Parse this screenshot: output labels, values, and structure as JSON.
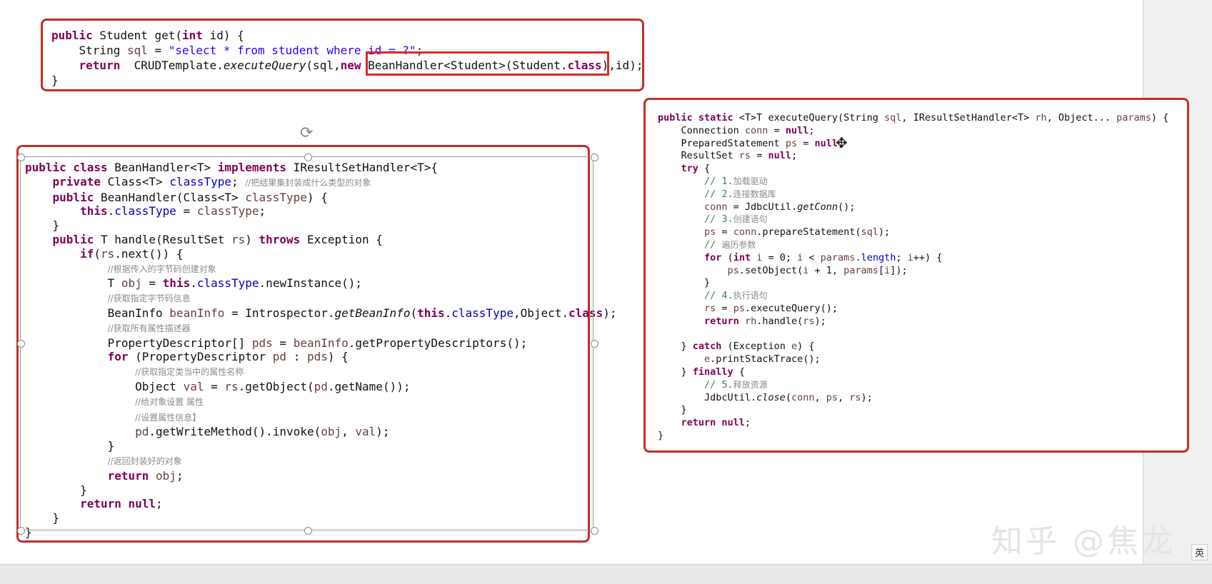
{
  "accent_color": "#c0302a",
  "watermark": "知乎 @焦龙",
  "ime": "英",
  "get_method": {
    "lines": [
      [
        [
          "kw",
          "public"
        ],
        [
          "t",
          " Student get("
        ],
        [
          "kw",
          "int"
        ],
        [
          "t",
          " id) {"
        ]
      ],
      [
        [
          "t",
          "    String "
        ],
        [
          "var",
          "sql"
        ],
        [
          "t",
          " = "
        ],
        [
          "str",
          "\"select * from student where id = ?\""
        ],
        [
          "t",
          ";"
        ]
      ],
      [
        [
          "t",
          "    "
        ],
        [
          "kw",
          "return"
        ],
        [
          "t",
          "  CRUDTemplate."
        ],
        [
          "mth",
          "executeQuery"
        ],
        [
          "t",
          "(sql,"
        ],
        [
          "kw",
          "new"
        ],
        [
          "t",
          " BeanHandler<Student>(Student."
        ],
        [
          "kw",
          "class"
        ],
        [
          "t",
          "),id);"
        ]
      ],
      [
        [
          "t",
          "}"
        ]
      ]
    ]
  },
  "bean_handler": {
    "lines": [
      [
        [
          "kw",
          "public class"
        ],
        [
          "t",
          " BeanHandler<T> "
        ],
        [
          "kw",
          "implements"
        ],
        [
          "t",
          " IResultSetHandler<T>{"
        ]
      ],
      [
        [
          "t",
          "    "
        ],
        [
          "kw",
          "private"
        ],
        [
          "t",
          " Class<T> "
        ],
        [
          "fld",
          "classType"
        ],
        [
          "t",
          "; "
        ],
        [
          "cmt",
          "//把结果集封装成什么类型的对象"
        ]
      ],
      [
        [
          "t",
          "    "
        ],
        [
          "kw",
          "public"
        ],
        [
          "t",
          " BeanHandler(Class<T> "
        ],
        [
          "var",
          "classType"
        ],
        [
          "t",
          ") {"
        ]
      ],
      [
        [
          "t",
          "        "
        ],
        [
          "kw",
          "this"
        ],
        [
          "t",
          "."
        ],
        [
          "fld",
          "classType"
        ],
        [
          "t",
          " = "
        ],
        [
          "var",
          "classType"
        ],
        [
          "t",
          ";"
        ]
      ],
      [
        [
          "t",
          "    }"
        ]
      ],
      [
        [
          "t",
          "    "
        ],
        [
          "kw",
          "public"
        ],
        [
          "t",
          " T handle(ResultSet "
        ],
        [
          "var",
          "rs"
        ],
        [
          "t",
          ") "
        ],
        [
          "kw",
          "throws"
        ],
        [
          "t",
          " Exception {"
        ]
      ],
      [
        [
          "t",
          "        "
        ],
        [
          "kw",
          "if"
        ],
        [
          "t",
          "("
        ],
        [
          "var",
          "rs"
        ],
        [
          "t",
          ".next()) {"
        ]
      ],
      [
        [
          "t",
          "            "
        ],
        [
          "cmt",
          "//根据传入的字节码创建对象"
        ]
      ],
      [
        [
          "t",
          "            T "
        ],
        [
          "var",
          "obj"
        ],
        [
          "t",
          " = "
        ],
        [
          "kw",
          "this"
        ],
        [
          "t",
          "."
        ],
        [
          "fld",
          "classType"
        ],
        [
          "t",
          ".newInstance();"
        ]
      ],
      [
        [
          "t",
          "            "
        ],
        [
          "cmt",
          "//获取指定字节码信息"
        ]
      ],
      [
        [
          "t",
          "            BeanInfo "
        ],
        [
          "var",
          "beanInfo"
        ],
        [
          "t",
          " = Introspector."
        ],
        [
          "mth",
          "getBeanInfo"
        ],
        [
          "t",
          "("
        ],
        [
          "kw",
          "this"
        ],
        [
          "t",
          "."
        ],
        [
          "fld",
          "classType"
        ],
        [
          "t",
          ",Object."
        ],
        [
          "kw",
          "class"
        ],
        [
          "t",
          ");"
        ]
      ],
      [
        [
          "t",
          "            "
        ],
        [
          "cmt",
          "//获取所有属性描述器"
        ]
      ],
      [
        [
          "t",
          "            PropertyDescriptor[] "
        ],
        [
          "var",
          "pds"
        ],
        [
          "t",
          " = "
        ],
        [
          "var",
          "beanInfo"
        ],
        [
          "t",
          ".getPropertyDescriptors();"
        ]
      ],
      [
        [
          "t",
          "            "
        ],
        [
          "kw",
          "for"
        ],
        [
          "t",
          " (PropertyDescriptor "
        ],
        [
          "var",
          "pd"
        ],
        [
          "t",
          " : "
        ],
        [
          "var",
          "pds"
        ],
        [
          "t",
          ") {"
        ]
      ],
      [
        [
          "t",
          "                "
        ],
        [
          "cmt",
          "//获取指定类当中的属性名称"
        ]
      ],
      [
        [
          "t",
          "                Object "
        ],
        [
          "var",
          "val"
        ],
        [
          "t",
          " = "
        ],
        [
          "var",
          "rs"
        ],
        [
          "t",
          ".getObject("
        ],
        [
          "var",
          "pd"
        ],
        [
          "t",
          ".getName());"
        ]
      ],
      [
        [
          "t",
          "                "
        ],
        [
          "cmt",
          "//给对象设置 属性"
        ]
      ],
      [
        [
          "t",
          "                "
        ],
        [
          "cmt",
          "//设置属性信息】"
        ]
      ],
      [
        [
          "t",
          "                "
        ],
        [
          "var",
          "pd"
        ],
        [
          "t",
          ".getWriteMethod().invoke("
        ],
        [
          "var",
          "obj"
        ],
        [
          "t",
          ", "
        ],
        [
          "var",
          "val"
        ],
        [
          "t",
          ");"
        ]
      ],
      [
        [
          "t",
          "            }"
        ]
      ],
      [
        [
          "t",
          "            "
        ],
        [
          "cmt",
          "//返回封装好的对象"
        ]
      ],
      [
        [
          "t",
          "            "
        ],
        [
          "kw",
          "return"
        ],
        [
          "t",
          " "
        ],
        [
          "var",
          "obj"
        ],
        [
          "t",
          ";"
        ]
      ],
      [
        [
          "t",
          "        }"
        ]
      ],
      [
        [
          "t",
          "        "
        ],
        [
          "kw",
          "return null"
        ],
        [
          "t",
          ";"
        ]
      ],
      [
        [
          "t",
          "    }"
        ]
      ],
      [
        [
          "t",
          "}"
        ]
      ]
    ]
  },
  "execute_query": {
    "lines": [
      [
        [
          "kw",
          "public static"
        ],
        [
          "t",
          " <T>T executeQuery(String "
        ],
        [
          "var",
          "sql"
        ],
        [
          "t",
          ", IResultSetHandler<T> "
        ],
        [
          "var",
          "rh"
        ],
        [
          "t",
          ", Object... "
        ],
        [
          "var",
          "params"
        ],
        [
          "t",
          ") {"
        ]
      ],
      [
        [
          "t",
          "    Connection "
        ],
        [
          "var",
          "conn"
        ],
        [
          "t",
          " = "
        ],
        [
          "kw",
          "null"
        ],
        [
          "t",
          ";"
        ]
      ],
      [
        [
          "t",
          "    PreparedStatement "
        ],
        [
          "var",
          "ps"
        ],
        [
          "t",
          " = "
        ],
        [
          "kw",
          "null"
        ],
        [
          "t",
          ";"
        ]
      ],
      [
        [
          "t",
          "    ResultSet "
        ],
        [
          "var",
          "rs"
        ],
        [
          "t",
          " = "
        ],
        [
          "kw",
          "null"
        ],
        [
          "t",
          ";"
        ]
      ],
      [
        [
          "t",
          "    "
        ],
        [
          "kw",
          "try"
        ],
        [
          "t",
          " {"
        ]
      ],
      [
        [
          "t",
          "        "
        ],
        [
          "cmtnum",
          "// 1."
        ],
        [
          "cmt",
          "加载驱动"
        ]
      ],
      [
        [
          "t",
          "        "
        ],
        [
          "cmtnum",
          "// 2."
        ],
        [
          "cmt",
          "连接数据库"
        ]
      ],
      [
        [
          "t",
          "        "
        ],
        [
          "var",
          "conn"
        ],
        [
          "t",
          " = JdbcUtil."
        ],
        [
          "mth",
          "getConn"
        ],
        [
          "t",
          "();"
        ]
      ],
      [
        [
          "t",
          "        "
        ],
        [
          "cmtnum",
          "// 3."
        ],
        [
          "cmt",
          "创建语句"
        ]
      ],
      [
        [
          "t",
          "        "
        ],
        [
          "var",
          "ps"
        ],
        [
          "t",
          " = "
        ],
        [
          "var",
          "conn"
        ],
        [
          "t",
          ".prepareStatement("
        ],
        [
          "var",
          "sql"
        ],
        [
          "t",
          ");"
        ]
      ],
      [
        [
          "t",
          "        "
        ],
        [
          "cmtnum",
          "// "
        ],
        [
          "cmt",
          "遍历参数"
        ]
      ],
      [
        [
          "t",
          "        "
        ],
        [
          "kw",
          "for"
        ],
        [
          "t",
          " ("
        ],
        [
          "kw",
          "int"
        ],
        [
          "t",
          " "
        ],
        [
          "var",
          "i"
        ],
        [
          "t",
          " = 0; "
        ],
        [
          "var",
          "i"
        ],
        [
          "t",
          " < "
        ],
        [
          "var",
          "params"
        ],
        [
          "t",
          "."
        ],
        [
          "fld",
          "length"
        ],
        [
          "t",
          "; "
        ],
        [
          "var",
          "i"
        ],
        [
          "t",
          "++) {"
        ]
      ],
      [
        [
          "t",
          "            "
        ],
        [
          "var",
          "ps"
        ],
        [
          "t",
          ".setObject("
        ],
        [
          "var",
          "i"
        ],
        [
          "t",
          " + 1, "
        ],
        [
          "var",
          "params"
        ],
        [
          "t",
          "["
        ],
        [
          "var",
          "i"
        ],
        [
          "t",
          "]);"
        ]
      ],
      [
        [
          "t",
          "        }"
        ]
      ],
      [
        [
          "t",
          "        "
        ],
        [
          "cmtnum",
          "// 4."
        ],
        [
          "cmt",
          "执行语句"
        ]
      ],
      [
        [
          "t",
          "        "
        ],
        [
          "var",
          "rs"
        ],
        [
          "t",
          " = "
        ],
        [
          "var",
          "ps"
        ],
        [
          "t",
          ".executeQuery();"
        ]
      ],
      [
        [
          "t",
          "        "
        ],
        [
          "kw",
          "return"
        ],
        [
          "t",
          " "
        ],
        [
          "var",
          "rh"
        ],
        [
          "t",
          ".handle("
        ],
        [
          "var",
          "rs"
        ],
        [
          "t",
          ");"
        ]
      ],
      [
        [
          "t",
          ""
        ]
      ],
      [
        [
          "t",
          "    } "
        ],
        [
          "kw",
          "catch"
        ],
        [
          "t",
          " (Exception "
        ],
        [
          "var",
          "e"
        ],
        [
          "t",
          ") {"
        ]
      ],
      [
        [
          "t",
          "        "
        ],
        [
          "var",
          "e"
        ],
        [
          "t",
          ".printStackTrace();"
        ]
      ],
      [
        [
          "t",
          "    } "
        ],
        [
          "kw",
          "finally"
        ],
        [
          "t",
          " {"
        ]
      ],
      [
        [
          "t",
          "        "
        ],
        [
          "cmtnum",
          "// 5."
        ],
        [
          "cmt",
          "释放资源"
        ]
      ],
      [
        [
          "t",
          "        JdbcUtil."
        ],
        [
          "mth",
          "close"
        ],
        [
          "t",
          "("
        ],
        [
          "var",
          "conn"
        ],
        [
          "t",
          ", "
        ],
        [
          "var",
          "ps"
        ],
        [
          "t",
          ", "
        ],
        [
          "var",
          "rs"
        ],
        [
          "t",
          ");"
        ]
      ],
      [
        [
          "t",
          "    }"
        ]
      ],
      [
        [
          "t",
          "    "
        ],
        [
          "kw",
          "return null"
        ],
        [
          "t",
          ";"
        ]
      ],
      [
        [
          "t",
          "}"
        ]
      ]
    ]
  }
}
